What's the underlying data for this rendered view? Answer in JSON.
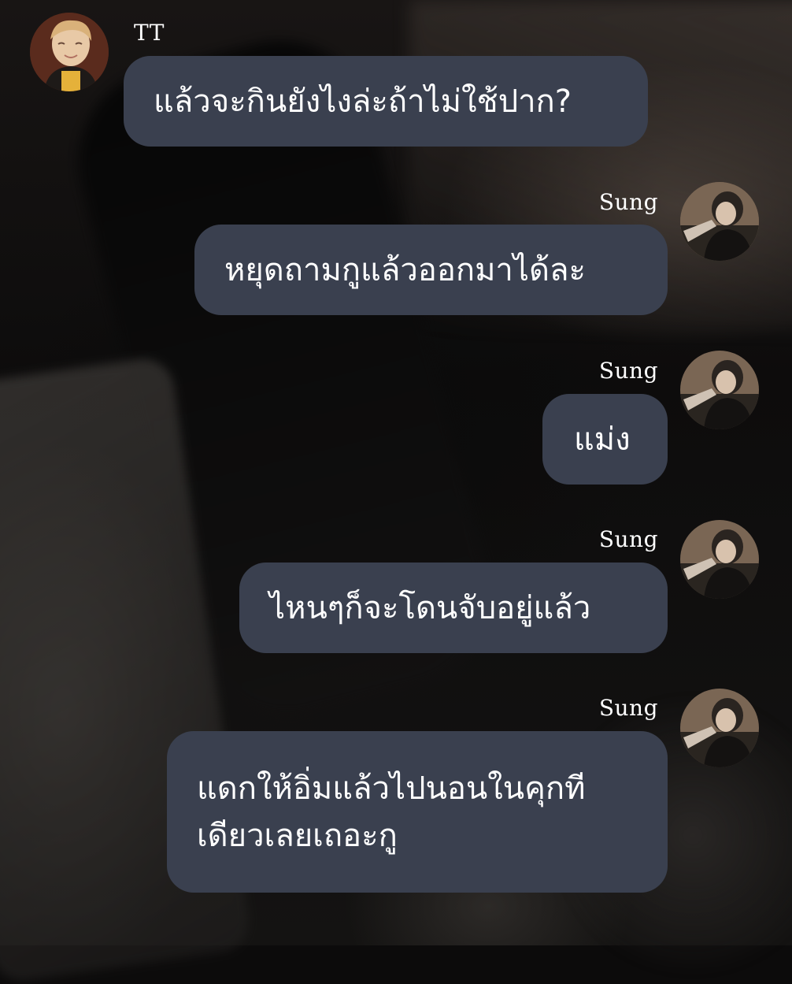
{
  "chat": {
    "messages": [
      {
        "sender": "TT",
        "text": "แล้วจะกินยังไงล่ะถ้าไม่ใช้ปาก?"
      },
      {
        "sender": "Sung",
        "text": "หยุดถามกูแล้วออกมาได้ละ"
      },
      {
        "sender": "Sung",
        "text": "แม่ง"
      },
      {
        "sender": "Sung",
        "text": "ไหนๆก็จะโดนจับอยู่แล้ว"
      },
      {
        "sender": "Sung",
        "text": "แดกให้อิ่มแล้วไปนอนในคุกที\nเดียวเลยเถอะกู"
      }
    ]
  },
  "colors": {
    "bubble": "#3a404f",
    "text": "#ffffff",
    "background": "#0c0b0b"
  }
}
